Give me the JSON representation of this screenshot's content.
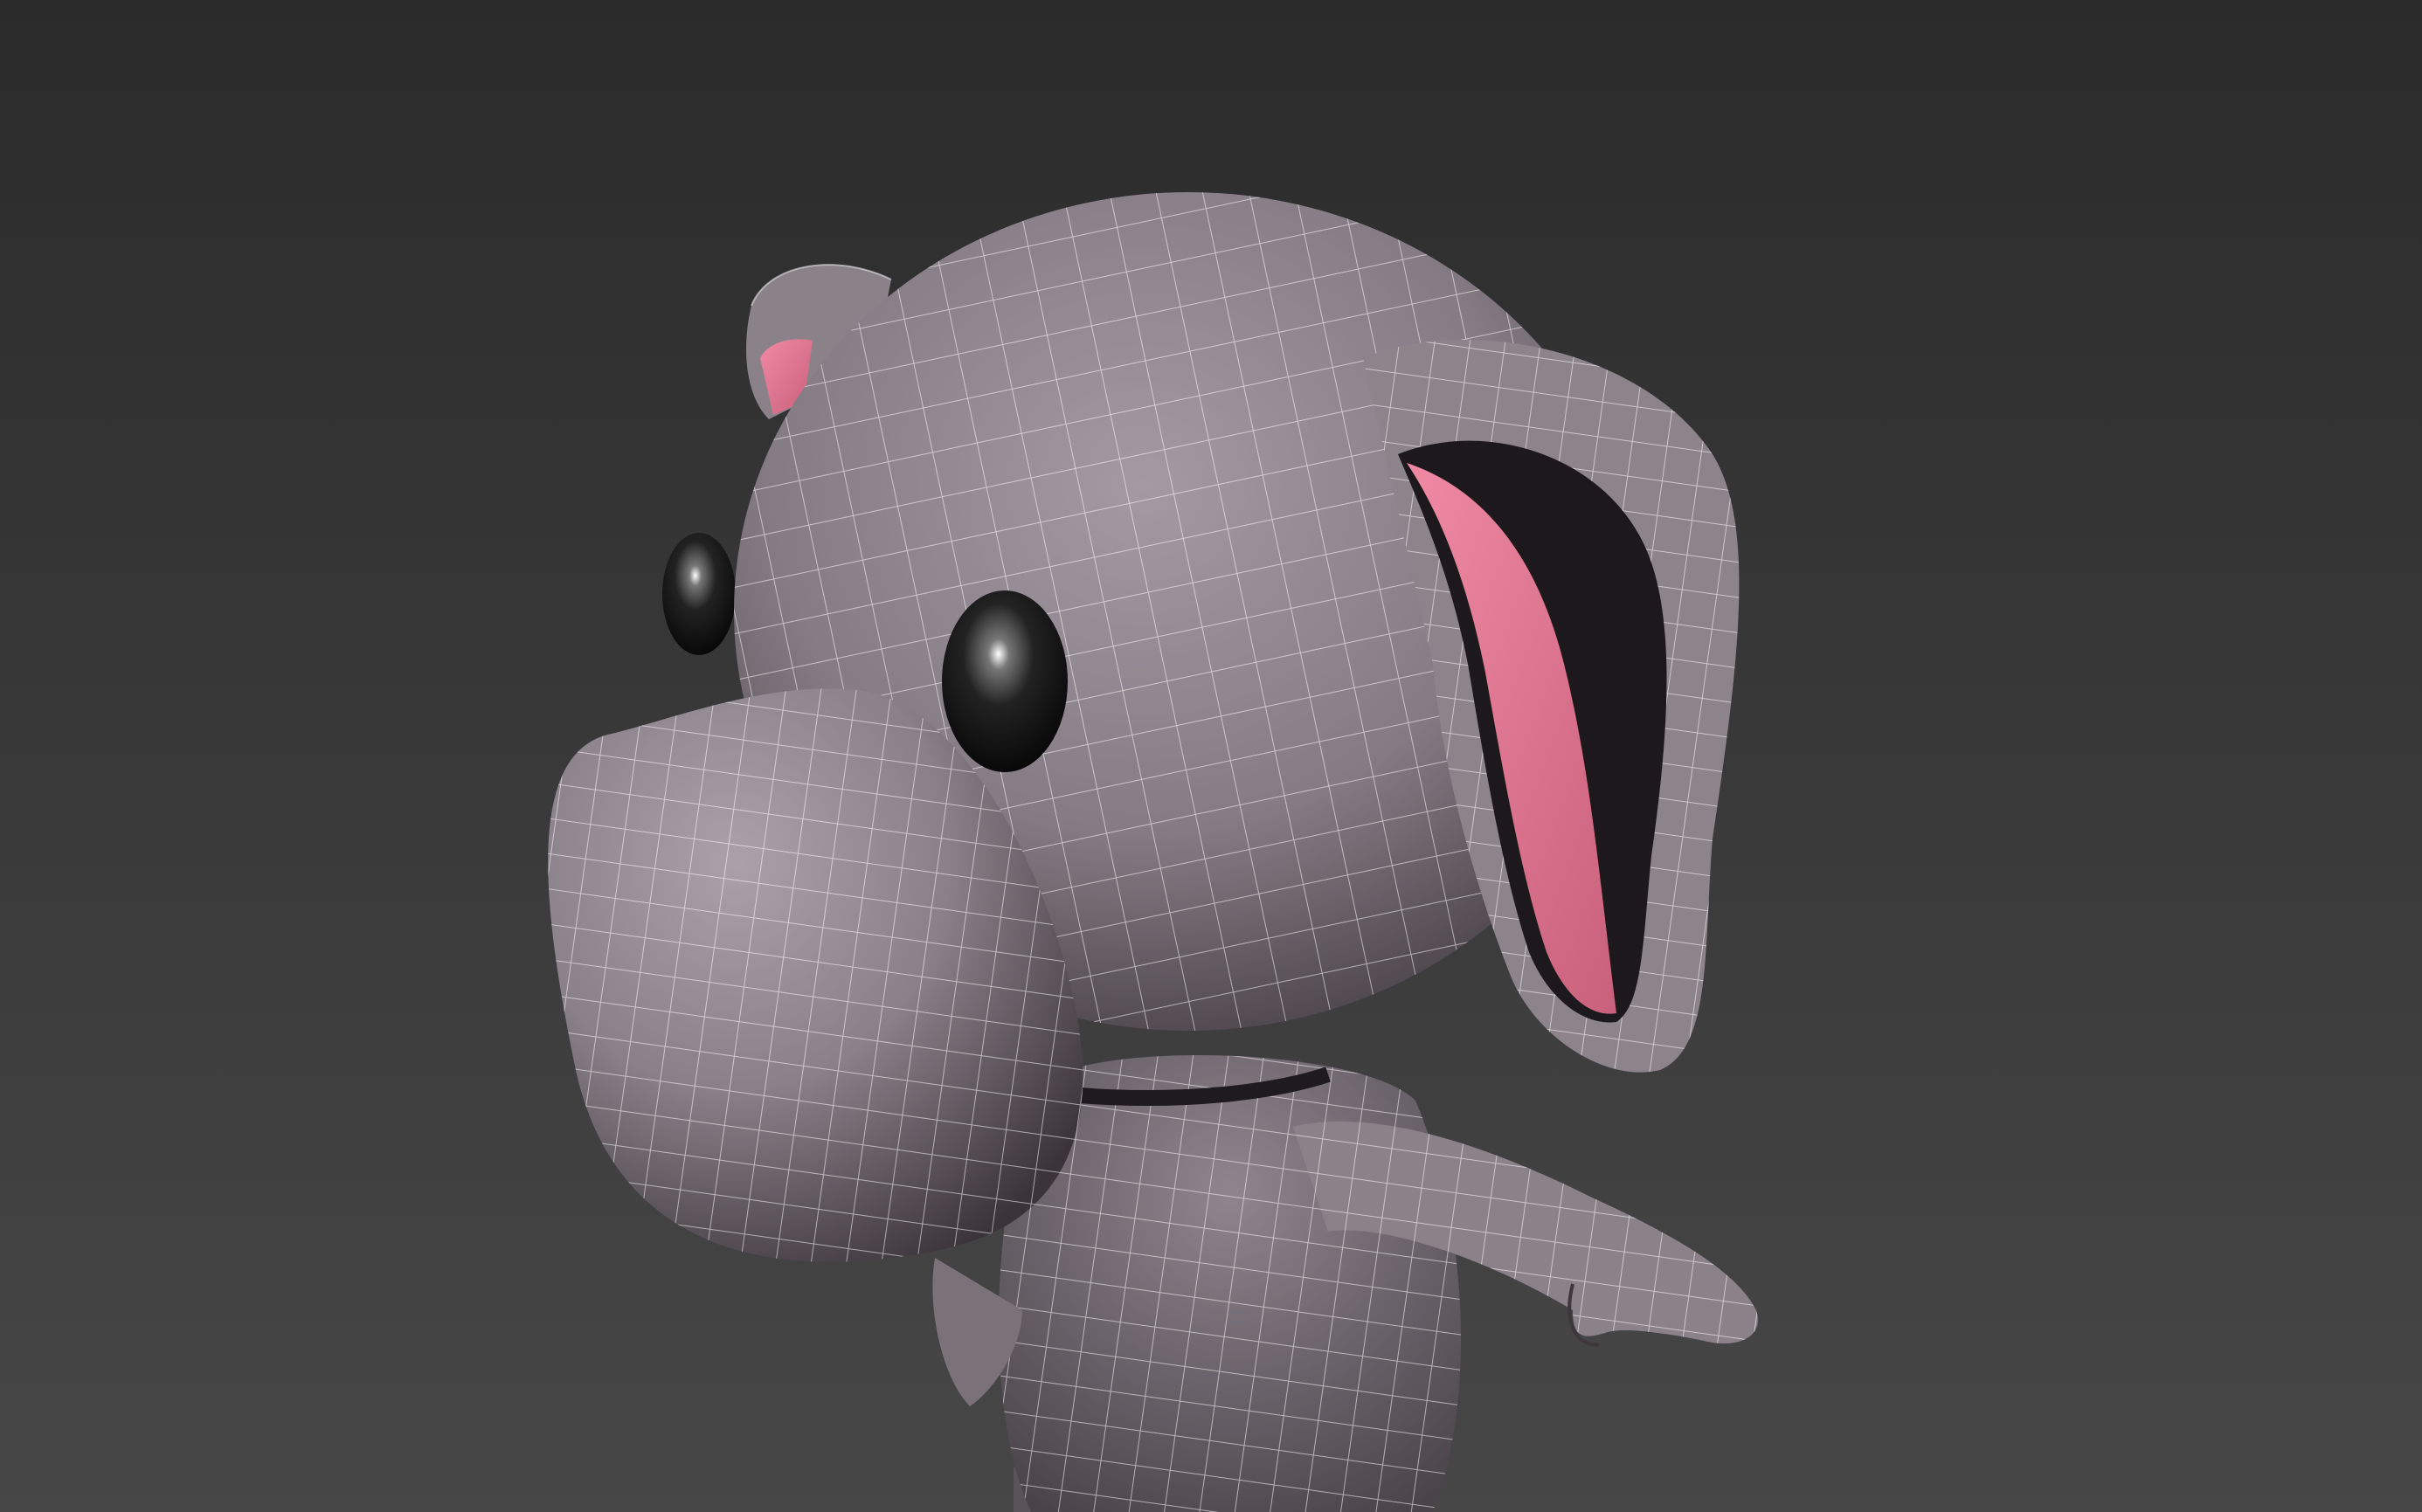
{
  "viewport": {
    "background_top": "#2b2b2b",
    "background_bottom": "#474747"
  },
  "model": {
    "skin_color": "#8e848c",
    "ear_inner_color": "#e37c97",
    "eye_color": "#111111",
    "wireframe_color": "#ffffff"
  }
}
